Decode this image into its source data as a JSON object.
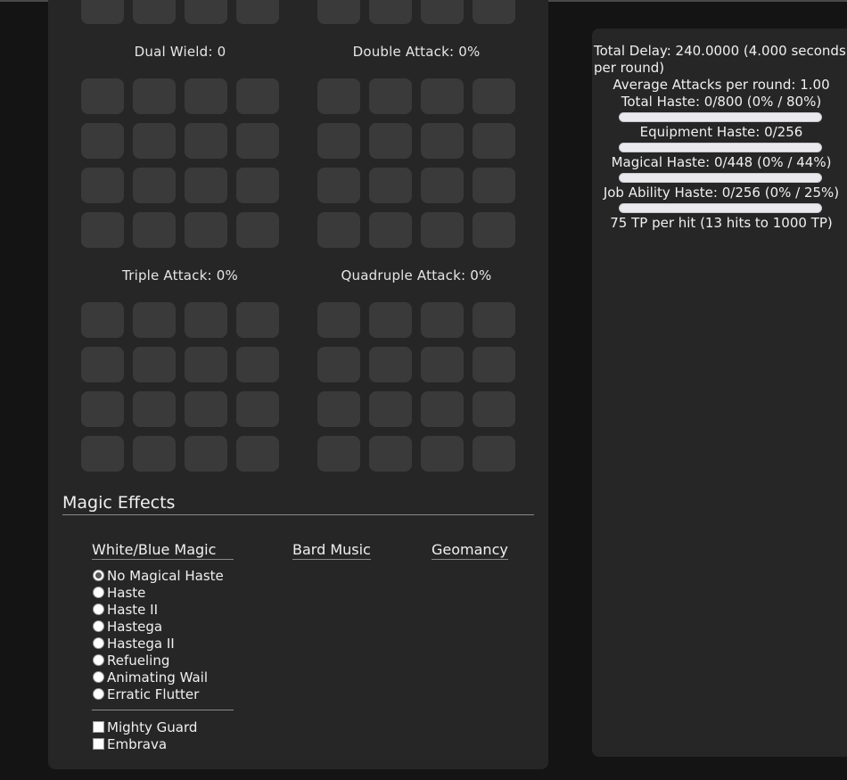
{
  "grids": [
    {
      "label": "Dual Wield: 0"
    },
    {
      "label": "Double Attack: 0%"
    },
    {
      "label": "Triple Attack: 0%"
    },
    {
      "label": "Quadruple Attack: 0%"
    }
  ],
  "magic": {
    "section_title": "Magic Effects",
    "columns": {
      "white_blue": "White/Blue Magic",
      "bard": "Bard Music",
      "geo": "Geomancy"
    },
    "radios": [
      {
        "label": "No Magical Haste",
        "selected": true
      },
      {
        "label": "Haste",
        "selected": false
      },
      {
        "label": "Haste II",
        "selected": false
      },
      {
        "label": "Hastega",
        "selected": false
      },
      {
        "label": "Hastega II",
        "selected": false
      },
      {
        "label": "Refueling",
        "selected": false
      },
      {
        "label": "Animating Wail",
        "selected": false
      },
      {
        "label": "Erratic Flutter",
        "selected": false
      }
    ],
    "checkboxes": [
      {
        "label": "Mighty Guard",
        "checked": false
      },
      {
        "label": "Embrava",
        "checked": false
      }
    ]
  },
  "stats": {
    "total_delay": "Total Delay: 240.0000 (4.000 seconds per round)",
    "avg_attacks": "Average Attacks per round: 1.00",
    "total_haste": "Total Haste: 0/800 (0% / 80%)",
    "total_haste_progress": 0,
    "equipment_haste": "Equipment Haste: 0/256",
    "equipment_haste_progress": 0,
    "magical_haste": "Magical Haste: 0/448 (0% / 44%)",
    "magical_haste_progress": 0,
    "ja_haste": "Job Ability Haste: 0/256 (0% / 25%)",
    "ja_haste_progress": 0,
    "tp": "75 TP per hit (13 hits to 1000 TP)"
  }
}
